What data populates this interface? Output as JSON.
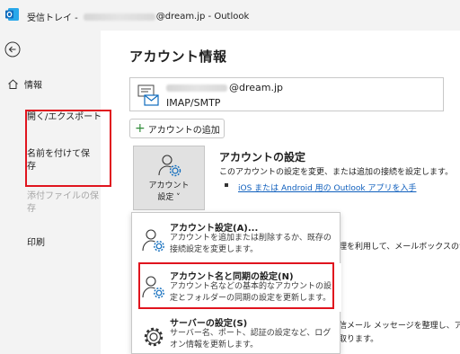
{
  "titlebar": {
    "folder": "受信トレイ - ",
    "email_domain": "@dream.jp",
    "separator": " - ",
    "app_name": "Outlook"
  },
  "nav": {
    "back_icon": "back-arrow-icon",
    "home_label": "情報",
    "open_export": "開く/エクスポート",
    "save_as_line1": "名前を付けて保",
    "save_as_line2": "存",
    "attach_line1": "添付ファイルの保",
    "attach_line2": "存",
    "print": "印刷"
  },
  "main": {
    "title": "アカウント情報",
    "account": {
      "email_domain": "@dream.jp",
      "type": "IMAP/SMTP"
    },
    "add_account_label": "アカウントの追加",
    "account_settings_button": {
      "line1": "アカウント",
      "line2": "設定 ˅"
    },
    "section": {
      "title": "アカウントの設定",
      "description": "このアカウントの設定を変更、または追加の接続を設定します。",
      "link": "iOS または Android 用の Outlook アプリを入手"
    },
    "background_text": {
      "line1": "理を利用して、メールボックスのサイ",
      "line2": "信メール メッセージを整理し、アイ",
      "line3": "取ります。"
    }
  },
  "menu": {
    "items": [
      {
        "title": "アカウント設定(A)...",
        "description": "アカウントを追加または削除するか、既存の接続設定を変更します。"
      },
      {
        "title": "アカウント名と同期の設定(N)",
        "description": "アカウント名などの基本的なアカウントの設定とフォルダーの同期の設定を更新します。"
      },
      {
        "title": "サーバーの設定(S)",
        "description": "サーバー名、ポート、認証の設定など、ログオン情報を更新します。"
      }
    ]
  },
  "colors": {
    "highlight_red": "#e0141e",
    "link_blue": "#0f5fbd",
    "outlook_blue": "#0f6cbd"
  }
}
